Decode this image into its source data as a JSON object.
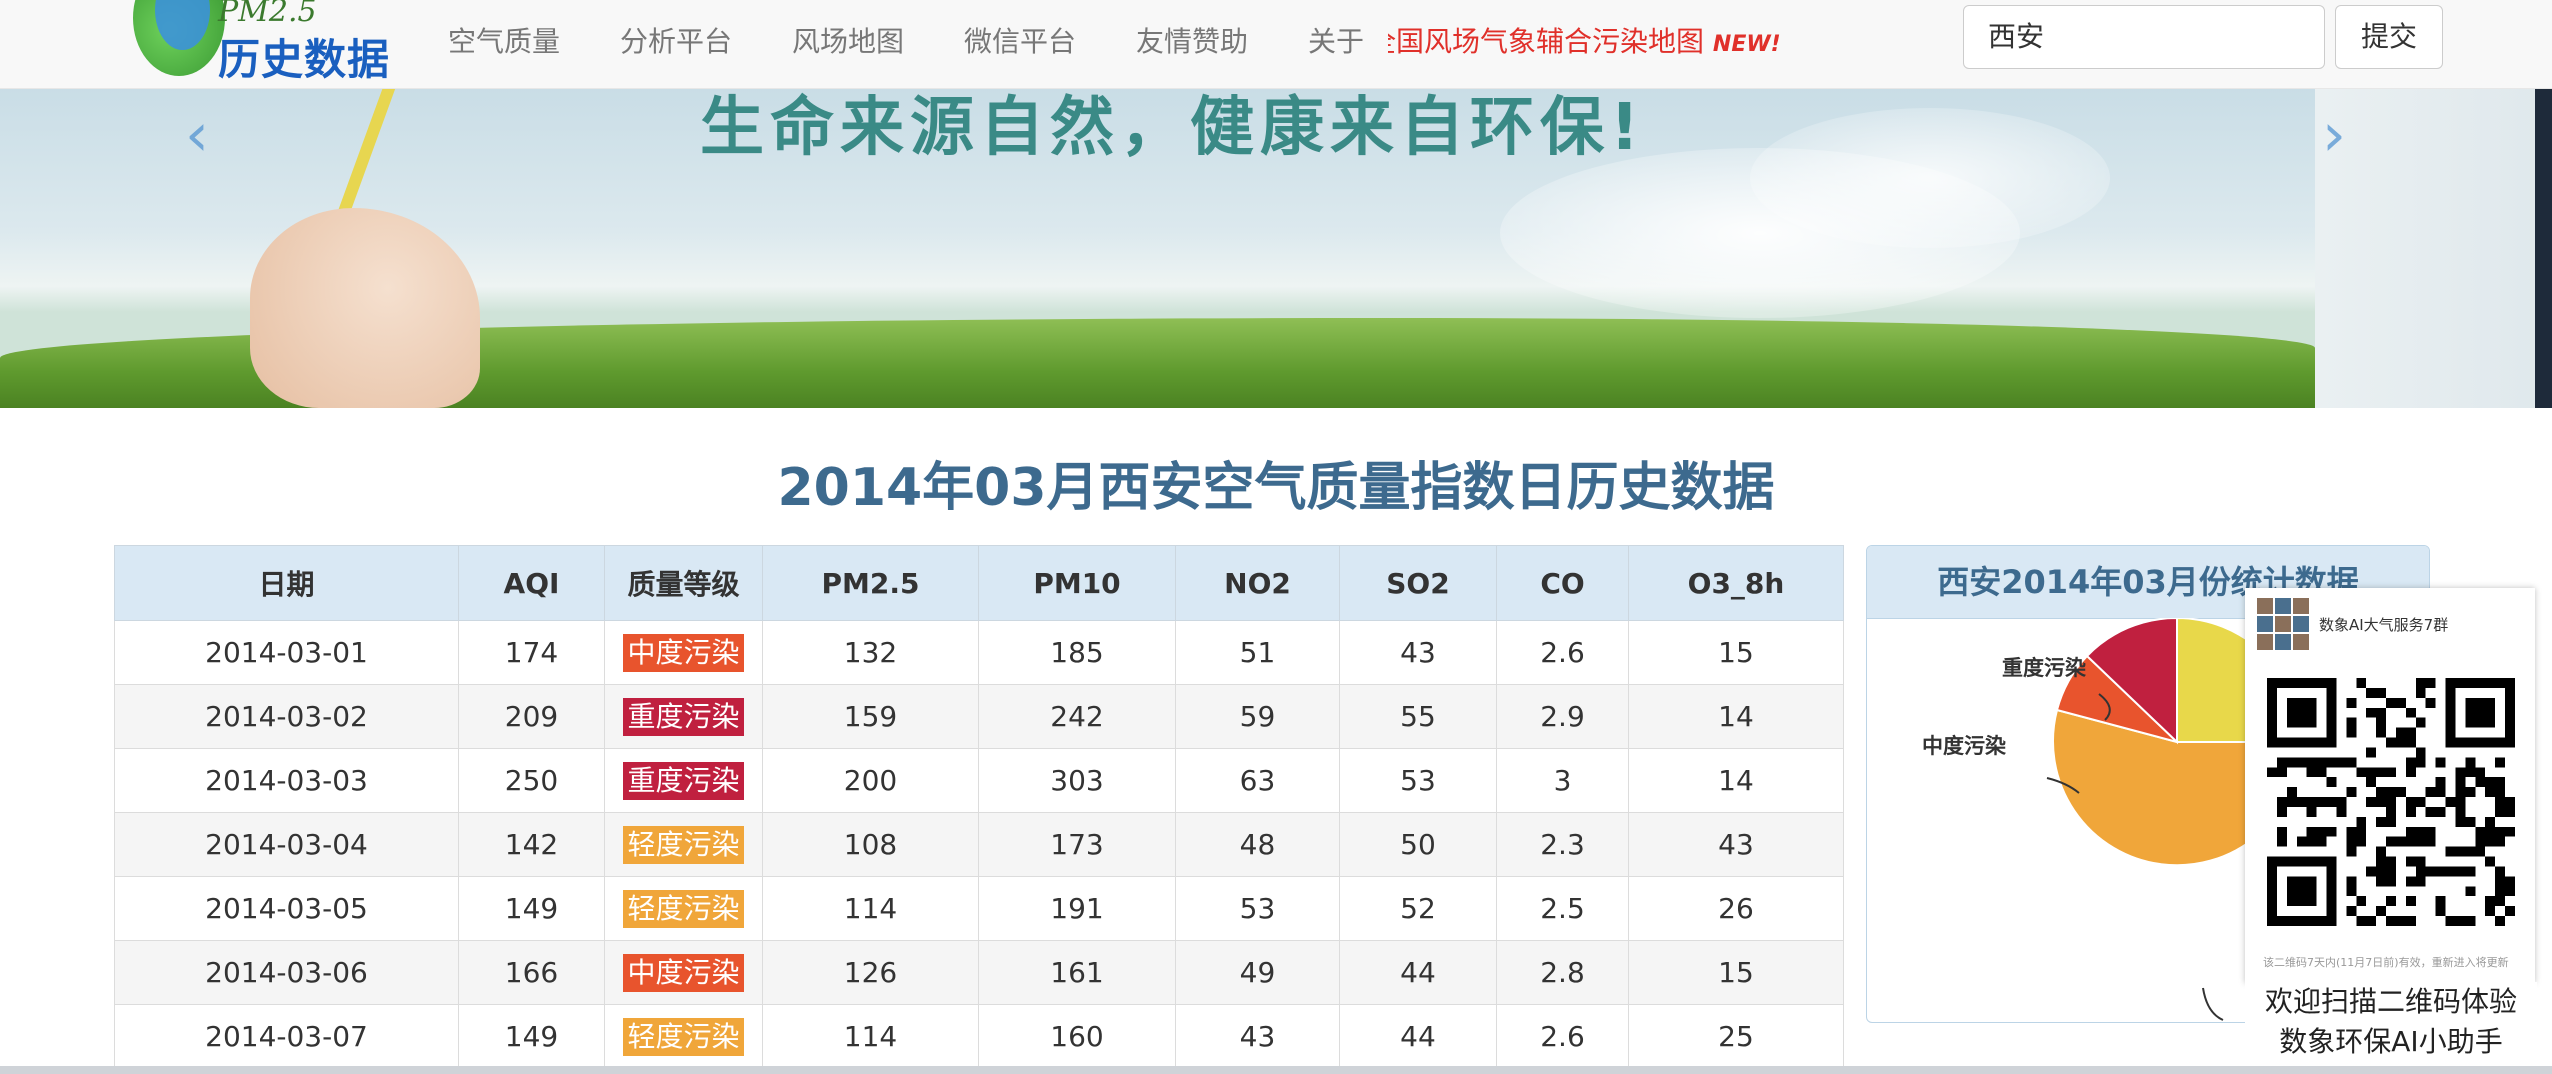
{
  "nav": {
    "logo_top": "PM2.5",
    "logo_bottom": "历史数据",
    "items": [
      "空气质量",
      "分析平台",
      "风场地图",
      "微信平台",
      "友情赞助",
      "关于"
    ],
    "marquee": "全国风场气象辅合污染地图",
    "marquee_badge": "NEW!",
    "search_value": "西安",
    "submit_label": "提交"
  },
  "banner": {
    "slogan": "生命来源自然，健康来自环保!",
    "prev": "‹",
    "next": "›"
  },
  "page_title": "2014年03月西安空气质量指数日历史数据",
  "table": {
    "headers": [
      "日期",
      "AQI",
      "质量等级",
      "PM2.5",
      "PM10",
      "NO2",
      "SO2",
      "CO",
      "O3_8h"
    ],
    "rows": [
      {
        "date": "2014-03-01",
        "aqi": "174",
        "level": "中度污染",
        "pm25": "132",
        "pm10": "185",
        "no2": "51",
        "so2": "43",
        "co": "2.6",
        "o3": "15"
      },
      {
        "date": "2014-03-02",
        "aqi": "209",
        "level": "重度污染",
        "pm25": "159",
        "pm10": "242",
        "no2": "59",
        "so2": "55",
        "co": "2.9",
        "o3": "14"
      },
      {
        "date": "2014-03-03",
        "aqi": "250",
        "level": "重度污染",
        "pm25": "200",
        "pm10": "303",
        "no2": "63",
        "so2": "53",
        "co": "3",
        "o3": "14"
      },
      {
        "date": "2014-03-04",
        "aqi": "142",
        "level": "轻度污染",
        "pm25": "108",
        "pm10": "173",
        "no2": "48",
        "so2": "50",
        "co": "2.3",
        "o3": "43"
      },
      {
        "date": "2014-03-05",
        "aqi": "149",
        "level": "轻度污染",
        "pm25": "114",
        "pm10": "191",
        "no2": "53",
        "so2": "52",
        "co": "2.5",
        "o3": "26"
      },
      {
        "date": "2014-03-06",
        "aqi": "166",
        "level": "中度污染",
        "pm25": "126",
        "pm10": "161",
        "no2": "49",
        "so2": "44",
        "co": "2.8",
        "o3": "15"
      },
      {
        "date": "2014-03-07",
        "aqi": "149",
        "level": "轻度污染",
        "pm25": "114",
        "pm10": "160",
        "no2": "43",
        "so2": "44",
        "co": "2.6",
        "o3": "25"
      }
    ]
  },
  "level_colors": {
    "轻度污染": "#f0a63a",
    "中度污染": "#e8542d",
    "重度污染": "#c0203f"
  },
  "stats": {
    "title": "西安2014年03月份统计数据",
    "labels": {
      "heavy": "重度污染",
      "moderate": "中度污染"
    }
  },
  "qr": {
    "group_name": "数象AI大气服务7群",
    "tip": "该二维码7天内(11月7日前)有效，重新进入将更新",
    "caption_line1": "欢迎扫描二维码体验",
    "caption_line2": "数象环保AI小助手"
  },
  "colors": {
    "title": "#3d6a8e",
    "header_bg": "#d9e8f4",
    "pie_yellow": "#e8d84a",
    "pie_orange": "#f0a63a",
    "pie_red": "#e8542d",
    "pie_crimson": "#c0203f"
  }
}
